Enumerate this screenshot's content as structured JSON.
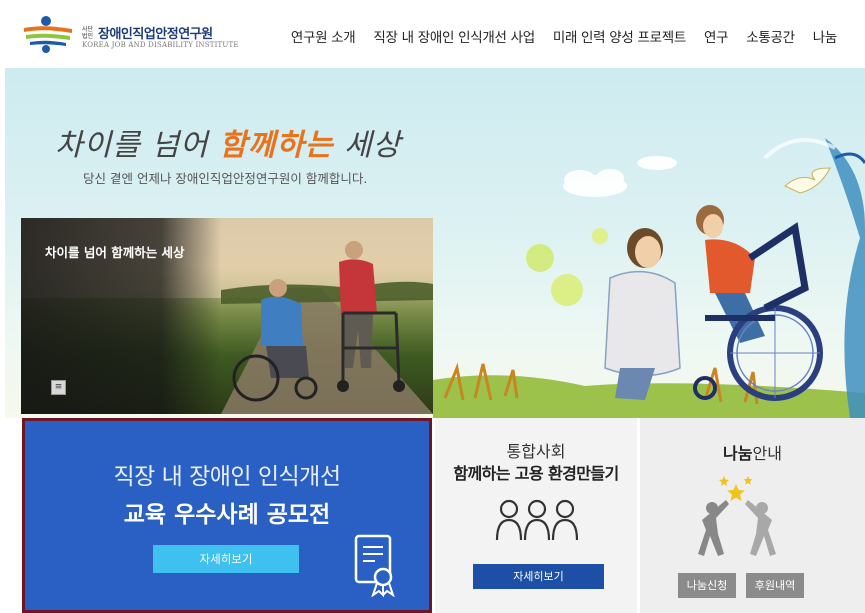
{
  "header": {
    "logo": {
      "small_text": "사단\n법인",
      "title": "장애인직업안정연구원",
      "subtitle": "KOREA JOB AND DISABILITY INSTITUTE"
    },
    "nav": [
      {
        "label": "연구원 소개"
      },
      {
        "label": "직장 내 장애인 인식개선 사업"
      },
      {
        "label": "미래 인력 양성 프로젝트"
      },
      {
        "label": "연구"
      },
      {
        "label": "소통공간"
      },
      {
        "label": "나눔"
      }
    ]
  },
  "hero": {
    "title_part1": "차이를 넘어 ",
    "title_highlight": "함께하는",
    "title_part2": " 세상",
    "subtitle": "당신 곁엔 언제나 장애인직업안정연구원이 함께합니다.",
    "photo_caption": "차이를 넘어 함께하는 세상",
    "menu_glyph": "≡"
  },
  "cards": {
    "contest": {
      "title_line1": "직장 내 장애인 인식개선",
      "title_line2": "교육 우수사례 공모전",
      "button": "자세히보기"
    },
    "employment": {
      "title_line1": "통합사회",
      "title_line2": "함께하는 고용 환경만들기",
      "button": "자세히보기"
    },
    "sharing": {
      "title_bold": "나눔",
      "title_rest": "안내",
      "button_apply": "나눔신청",
      "button_history": "후원내역"
    }
  },
  "colors": {
    "primary_blue": "#2a5fc3",
    "accent_cyan": "#3ec1ef",
    "nav_blue": "#1e4fa6",
    "highlight_orange": "#e8731c",
    "card_border": "#6e1526"
  }
}
